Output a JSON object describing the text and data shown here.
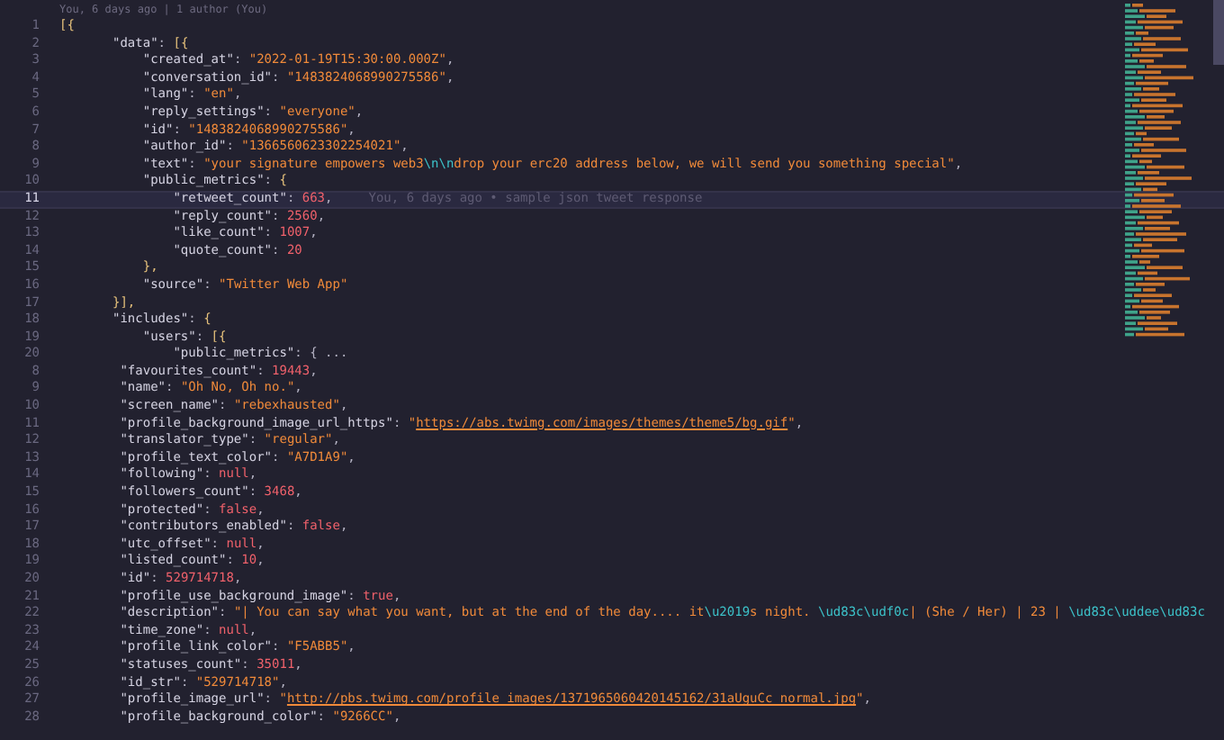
{
  "editor": {
    "blame_header": "You, 6 days ago | 1 author (You)",
    "lines": [
      {
        "number": "1",
        "current": false,
        "tokens": [
          {
            "kind": "bracket",
            "text": "[{"
          }
        ]
      },
      {
        "number": "2",
        "current": false,
        "tokens": [
          {
            "kind": "key",
            "text": "       \"data\""
          },
          {
            "kind": "punct",
            "text": ": "
          },
          {
            "kind": "bracket",
            "text": "[{"
          }
        ]
      },
      {
        "number": "3",
        "current": false,
        "tokens": [
          {
            "kind": "key",
            "text": "           \"created_at\""
          },
          {
            "kind": "punct",
            "text": ": "
          },
          {
            "kind": "string",
            "text": "\"2022-01-19T15:30:00.000Z\""
          },
          {
            "kind": "punct",
            "text": ","
          }
        ]
      },
      {
        "number": "4",
        "current": false,
        "tokens": [
          {
            "kind": "key",
            "text": "           \"conversation_id\""
          },
          {
            "kind": "punct",
            "text": ": "
          },
          {
            "kind": "string",
            "text": "\"1483824068990275586\""
          },
          {
            "kind": "punct",
            "text": ","
          }
        ]
      },
      {
        "number": "5",
        "current": false,
        "tokens": [
          {
            "kind": "key",
            "text": "           \"lang\""
          },
          {
            "kind": "punct",
            "text": ": "
          },
          {
            "kind": "string",
            "text": "\"en\""
          },
          {
            "kind": "punct",
            "text": ","
          }
        ]
      },
      {
        "number": "6",
        "current": false,
        "tokens": [
          {
            "kind": "key",
            "text": "           \"reply_settings\""
          },
          {
            "kind": "punct",
            "text": ": "
          },
          {
            "kind": "string",
            "text": "\"everyone\""
          },
          {
            "kind": "punct",
            "text": ","
          }
        ]
      },
      {
        "number": "7",
        "current": false,
        "tokens": [
          {
            "kind": "key",
            "text": "           \"id\""
          },
          {
            "kind": "punct",
            "text": ": "
          },
          {
            "kind": "string",
            "text": "\"1483824068990275586\""
          },
          {
            "kind": "punct",
            "text": ","
          }
        ]
      },
      {
        "number": "8",
        "current": false,
        "tokens": [
          {
            "kind": "key",
            "text": "           \"author_id\""
          },
          {
            "kind": "punct",
            "text": ": "
          },
          {
            "kind": "string",
            "text": "\"1366560623302254021\""
          },
          {
            "kind": "punct",
            "text": ","
          }
        ]
      },
      {
        "number": "9",
        "current": false,
        "tokens": [
          {
            "kind": "key",
            "text": "           \"text\""
          },
          {
            "kind": "punct",
            "text": ": "
          },
          {
            "kind": "string",
            "text": "\"your signature empowers web3"
          },
          {
            "kind": "escape",
            "text": "\\n\\n"
          },
          {
            "kind": "string",
            "text": "drop your erc20 address below, we will send you something special\""
          },
          {
            "kind": "punct",
            "text": ","
          }
        ]
      },
      {
        "number": "10",
        "current": false,
        "tokens": [
          {
            "kind": "key",
            "text": "           \"public_metrics\""
          },
          {
            "kind": "punct",
            "text": ": "
          },
          {
            "kind": "bracket",
            "text": "{"
          }
        ]
      },
      {
        "number": "11",
        "current": true,
        "blame": "You, 6 days ago • sample json tweet response",
        "tokens": [
          {
            "kind": "key",
            "text": "               \"retweet_count\""
          },
          {
            "kind": "punct",
            "text": ": "
          },
          {
            "kind": "number",
            "text": "663"
          },
          {
            "kind": "punct",
            "text": ","
          }
        ]
      },
      {
        "number": "12",
        "current": false,
        "tokens": [
          {
            "kind": "key",
            "text": "               \"reply_count\""
          },
          {
            "kind": "punct",
            "text": ": "
          },
          {
            "kind": "number",
            "text": "2560"
          },
          {
            "kind": "punct",
            "text": ","
          }
        ]
      },
      {
        "number": "13",
        "current": false,
        "tokens": [
          {
            "kind": "key",
            "text": "               \"like_count\""
          },
          {
            "kind": "punct",
            "text": ": "
          },
          {
            "kind": "number",
            "text": "1007"
          },
          {
            "kind": "punct",
            "text": ","
          }
        ]
      },
      {
        "number": "14",
        "current": false,
        "tokens": [
          {
            "kind": "key",
            "text": "               \"quote_count\""
          },
          {
            "kind": "punct",
            "text": ": "
          },
          {
            "kind": "number",
            "text": "20"
          }
        ]
      },
      {
        "number": "15",
        "current": false,
        "tokens": [
          {
            "kind": "bracket",
            "text": "           },"
          }
        ]
      },
      {
        "number": "16",
        "current": false,
        "tokens": [
          {
            "kind": "key",
            "text": "           \"source\""
          },
          {
            "kind": "punct",
            "text": ": "
          },
          {
            "kind": "string",
            "text": "\"Twitter Web App\""
          }
        ]
      },
      {
        "number": "17",
        "current": false,
        "tokens": [
          {
            "kind": "bracket",
            "text": "       }],"
          }
        ]
      },
      {
        "number": "18",
        "current": false,
        "tokens": [
          {
            "kind": "key",
            "text": "       \"includes\""
          },
          {
            "kind": "punct",
            "text": ": "
          },
          {
            "kind": "bracket",
            "text": "{"
          }
        ]
      },
      {
        "number": "19",
        "current": false,
        "tokens": [
          {
            "kind": "key",
            "text": "           \"users\""
          },
          {
            "kind": "punct",
            "text": ": "
          },
          {
            "kind": "bracket",
            "text": "[{"
          }
        ]
      },
      {
        "number": "20",
        "current": false,
        "tokens": [
          {
            "kind": "key",
            "text": "               \"public_metrics\""
          },
          {
            "kind": "punct",
            "text": ": { ..."
          }
        ]
      },
      {
        "number": "8",
        "current": false,
        "tokens": [
          {
            "kind": "key",
            "text": "        \"favourites_count\""
          },
          {
            "kind": "punct",
            "text": ": "
          },
          {
            "kind": "number",
            "text": "19443"
          },
          {
            "kind": "punct",
            "text": ","
          }
        ]
      },
      {
        "number": "9",
        "current": false,
        "tokens": [
          {
            "kind": "key",
            "text": "        \"name\""
          },
          {
            "kind": "punct",
            "text": ": "
          },
          {
            "kind": "string",
            "text": "\"Oh No, Oh no.\""
          },
          {
            "kind": "punct",
            "text": ","
          }
        ]
      },
      {
        "number": "10",
        "current": false,
        "tokens": [
          {
            "kind": "key",
            "text": "        \"screen_name\""
          },
          {
            "kind": "punct",
            "text": ": "
          },
          {
            "kind": "string",
            "text": "\"rebexhausted\""
          },
          {
            "kind": "punct",
            "text": ","
          }
        ]
      },
      {
        "number": "11",
        "current": false,
        "tokens": [
          {
            "kind": "key",
            "text": "        \"profile_background_image_url_https\""
          },
          {
            "kind": "punct",
            "text": ": "
          },
          {
            "kind": "string",
            "text": "\""
          },
          {
            "kind": "link",
            "text": "https://abs.twimg.com/images/themes/theme5/bg.gif"
          },
          {
            "kind": "string",
            "text": "\""
          },
          {
            "kind": "punct",
            "text": ","
          }
        ]
      },
      {
        "number": "12",
        "current": false,
        "tokens": [
          {
            "kind": "key",
            "text": "        \"translator_type\""
          },
          {
            "kind": "punct",
            "text": ": "
          },
          {
            "kind": "string",
            "text": "\"regular\""
          },
          {
            "kind": "punct",
            "text": ","
          }
        ]
      },
      {
        "number": "13",
        "current": false,
        "tokens": [
          {
            "kind": "key",
            "text": "        \"profile_text_color\""
          },
          {
            "kind": "punct",
            "text": ": "
          },
          {
            "kind": "string",
            "text": "\"A7D1A9\""
          },
          {
            "kind": "punct",
            "text": ","
          }
        ]
      },
      {
        "number": "14",
        "current": false,
        "tokens": [
          {
            "kind": "key",
            "text": "        \"following\""
          },
          {
            "kind": "punct",
            "text": ": "
          },
          {
            "kind": "literal",
            "text": "null"
          },
          {
            "kind": "punct",
            "text": ","
          }
        ]
      },
      {
        "number": "15",
        "current": false,
        "tokens": [
          {
            "kind": "key",
            "text": "        \"followers_count\""
          },
          {
            "kind": "punct",
            "text": ": "
          },
          {
            "kind": "number",
            "text": "3468"
          },
          {
            "kind": "punct",
            "text": ","
          }
        ]
      },
      {
        "number": "16",
        "current": false,
        "tokens": [
          {
            "kind": "key",
            "text": "        \"protected\""
          },
          {
            "kind": "punct",
            "text": ": "
          },
          {
            "kind": "literal",
            "text": "false"
          },
          {
            "kind": "punct",
            "text": ","
          }
        ]
      },
      {
        "number": "17",
        "current": false,
        "tokens": [
          {
            "kind": "key",
            "text": "        \"contributors_enabled\""
          },
          {
            "kind": "punct",
            "text": ": "
          },
          {
            "kind": "literal",
            "text": "false"
          },
          {
            "kind": "punct",
            "text": ","
          }
        ]
      },
      {
        "number": "18",
        "current": false,
        "tokens": [
          {
            "kind": "key",
            "text": "        \"utc_offset\""
          },
          {
            "kind": "punct",
            "text": ": "
          },
          {
            "kind": "literal",
            "text": "null"
          },
          {
            "kind": "punct",
            "text": ","
          }
        ]
      },
      {
        "number": "19",
        "current": false,
        "tokens": [
          {
            "kind": "key",
            "text": "        \"listed_count\""
          },
          {
            "kind": "punct",
            "text": ": "
          },
          {
            "kind": "number",
            "text": "10"
          },
          {
            "kind": "punct",
            "text": ","
          }
        ]
      },
      {
        "number": "20",
        "current": false,
        "tokens": [
          {
            "kind": "key",
            "text": "        \"id\""
          },
          {
            "kind": "punct",
            "text": ": "
          },
          {
            "kind": "number",
            "text": "529714718"
          },
          {
            "kind": "punct",
            "text": ","
          }
        ]
      },
      {
        "number": "21",
        "current": false,
        "tokens": [
          {
            "kind": "key",
            "text": "        \"profile_use_background_image\""
          },
          {
            "kind": "punct",
            "text": ": "
          },
          {
            "kind": "literal",
            "text": "true"
          },
          {
            "kind": "punct",
            "text": ","
          }
        ]
      },
      {
        "number": "22",
        "current": false,
        "tokens": [
          {
            "kind": "key",
            "text": "        \"description\""
          },
          {
            "kind": "punct",
            "text": ": "
          },
          {
            "kind": "string",
            "text": "\"| You can say what you want, but at the end of the day.... it"
          },
          {
            "kind": "escape",
            "text": "\\u2019"
          },
          {
            "kind": "string",
            "text": "s night. "
          },
          {
            "kind": "escape",
            "text": "\\ud83c\\udf0c"
          },
          {
            "kind": "string",
            "text": "| (She / Her) | 23 | "
          },
          {
            "kind": "escape",
            "text": "\\ud83c\\uddee\\ud83c"
          }
        ]
      },
      {
        "number": "23",
        "current": false,
        "tokens": [
          {
            "kind": "key",
            "text": "        \"time_zone\""
          },
          {
            "kind": "punct",
            "text": ": "
          },
          {
            "kind": "literal",
            "text": "null"
          },
          {
            "kind": "punct",
            "text": ","
          }
        ]
      },
      {
        "number": "24",
        "current": false,
        "tokens": [
          {
            "kind": "key",
            "text": "        \"profile_link_color\""
          },
          {
            "kind": "punct",
            "text": ": "
          },
          {
            "kind": "string",
            "text": "\"F5ABB5\""
          },
          {
            "kind": "punct",
            "text": ","
          }
        ]
      },
      {
        "number": "25",
        "current": false,
        "tokens": [
          {
            "kind": "key",
            "text": "        \"statuses_count\""
          },
          {
            "kind": "punct",
            "text": ": "
          },
          {
            "kind": "number",
            "text": "35011"
          },
          {
            "kind": "punct",
            "text": ","
          }
        ]
      },
      {
        "number": "26",
        "current": false,
        "tokens": [
          {
            "kind": "key",
            "text": "        \"id_str\""
          },
          {
            "kind": "punct",
            "text": ": "
          },
          {
            "kind": "string",
            "text": "\"529714718\""
          },
          {
            "kind": "punct",
            "text": ","
          }
        ]
      },
      {
        "number": "27",
        "current": false,
        "tokens": [
          {
            "kind": "key",
            "text": "        \"profile_image_url\""
          },
          {
            "kind": "punct",
            "text": ": "
          },
          {
            "kind": "string",
            "text": "\""
          },
          {
            "kind": "link",
            "text": "http://pbs.twimg.com/profile_images/1371965060420145162/31aUguCc_normal.jpg"
          },
          {
            "kind": "string",
            "text": "\""
          },
          {
            "kind": "punct",
            "text": ","
          }
        ]
      },
      {
        "number": "28",
        "current": false,
        "tokens": [
          {
            "kind": "key",
            "text": "        \"profile_background_color\""
          },
          {
            "kind": "punct",
            "text": ": "
          },
          {
            "kind": "string",
            "text": "\"9266CC\""
          },
          {
            "kind": "punct",
            "text": ","
          }
        ]
      }
    ]
  }
}
